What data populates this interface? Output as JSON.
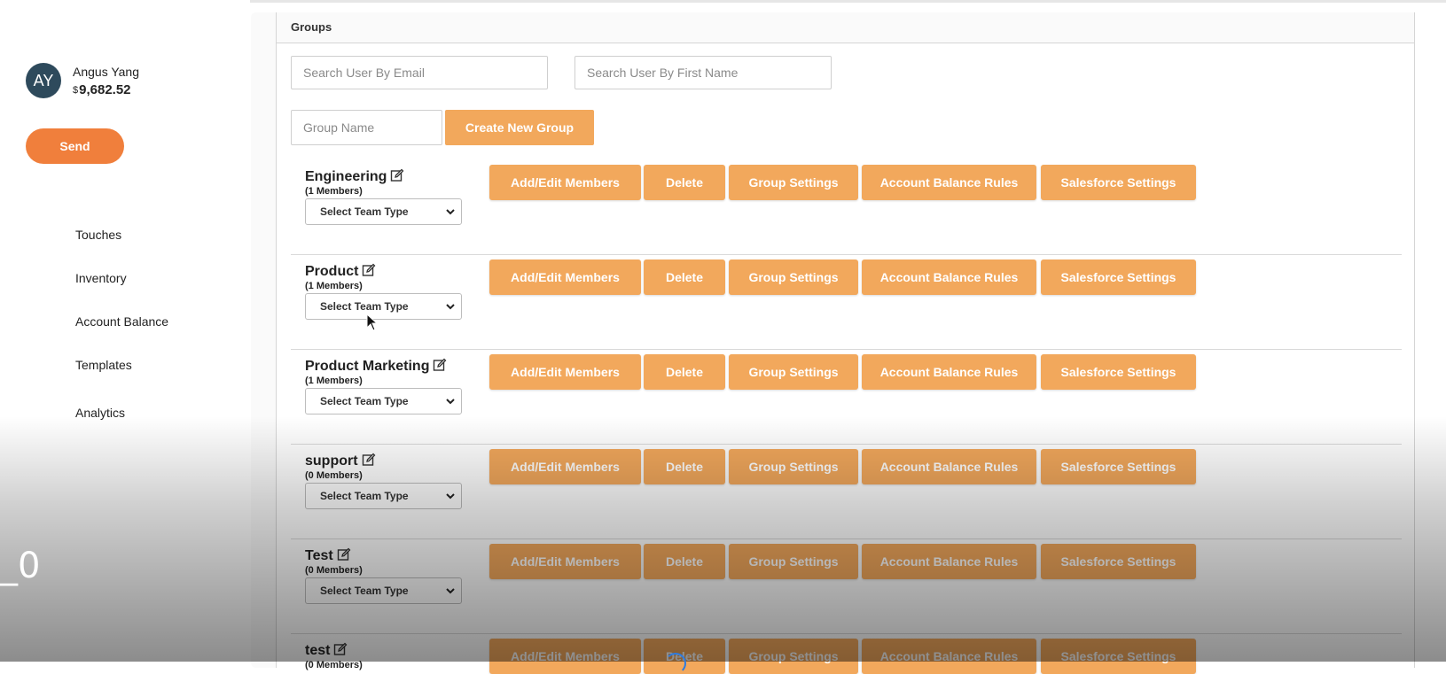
{
  "user": {
    "initials": "AY",
    "name": "Angus Yang",
    "currency": "$",
    "balance": "9,682.52"
  },
  "sidebar": {
    "send_label": "Send",
    "items": [
      {
        "label": "Touches"
      },
      {
        "label": "Inventory"
      },
      {
        "label": "Account Balance"
      },
      {
        "label": "Templates"
      },
      {
        "label": "Analytics"
      }
    ]
  },
  "main": {
    "title": "Groups",
    "search_email_placeholder": "Search User By Email",
    "search_firstname_placeholder": "Search User By First Name",
    "group_name_placeholder": "Group Name",
    "create_label": "Create New Group",
    "select_label": "Select Team Type",
    "actions": {
      "add_edit": "Add/Edit Members",
      "delete": "Delete",
      "group_settings": "Group Settings",
      "balance_rules": "Account Balance Rules",
      "salesforce": "Salesforce Settings"
    },
    "groups": [
      {
        "name": "Engineering",
        "members": "(1 Members)"
      },
      {
        "name": "Product",
        "members": "(1 Members)"
      },
      {
        "name": "Product Marketing",
        "members": "(1 Members)"
      },
      {
        "name": "support",
        "members": "(0 Members)"
      },
      {
        "name": "Test",
        "members": "(0 Members)"
      },
      {
        "name": "test",
        "members": "(0 Members)"
      }
    ]
  },
  "overlay": {
    "text": "_0"
  },
  "colors": {
    "accent": "#f07f3c",
    "button": "#f2a85c",
    "avatar": "#2e4a5c"
  }
}
